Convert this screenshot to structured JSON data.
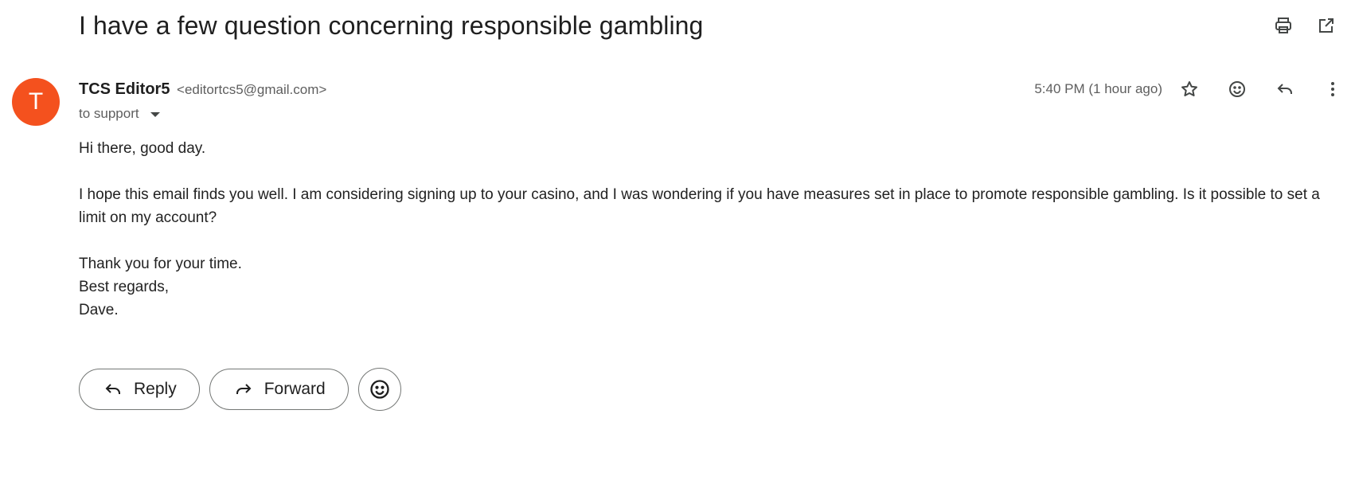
{
  "email": {
    "subject": "I have a few question concerning responsible gambling",
    "avatar_letter": "T",
    "avatar_color": "#f4511e",
    "sender_name": "TCS Editor5",
    "sender_email": "<editortcs5@gmail.com>",
    "to_label": "to support",
    "timestamp": "5:40 PM (1 hour ago)",
    "body": {
      "greeting": "Hi there, good day.",
      "paragraph": "I hope this email finds you well. I am considering signing up to your casino, and I was wondering if you have measures set in place to promote responsible gambling. Is it possible to set a limit on my account?",
      "thanks": "Thank you for your time.",
      "closing": "Best regards,",
      "signature": "Dave."
    }
  },
  "top_actions": {
    "print_icon": "print-icon",
    "open_new_window_icon": "open-in-new-window-icon"
  },
  "header_actions": {
    "star_icon": "star-icon",
    "emoji_icon": "emoji-icon",
    "reply_icon": "reply-icon",
    "more_icon": "more-vertical-icon"
  },
  "buttons": {
    "reply_label": "Reply",
    "forward_label": "Forward"
  }
}
